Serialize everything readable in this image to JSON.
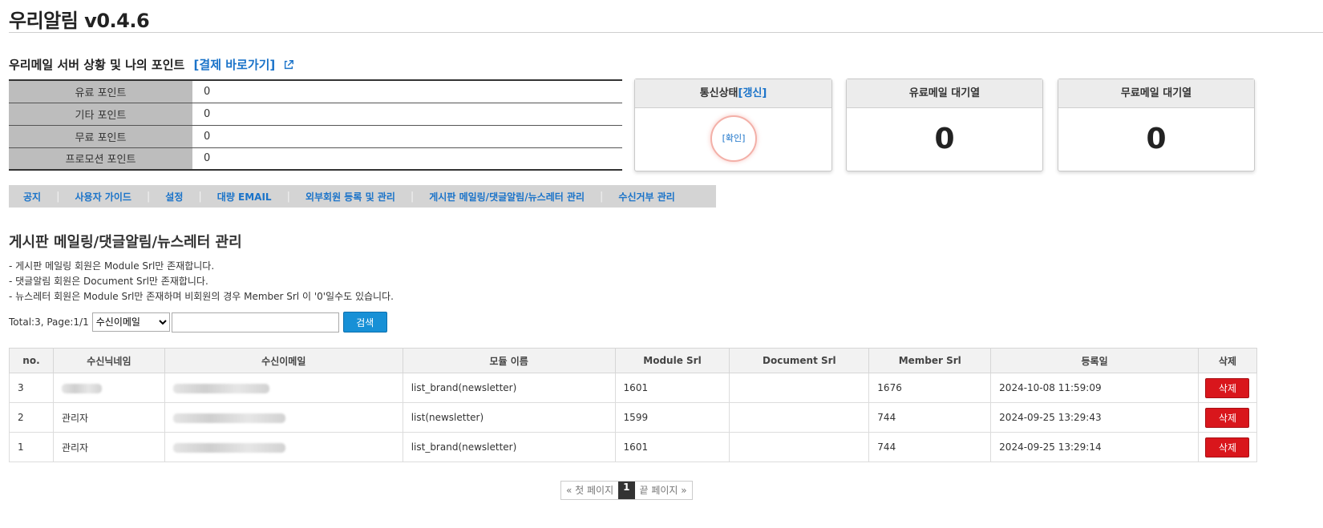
{
  "app": {
    "title": "우리알림 v0.4.6"
  },
  "points_section": {
    "heading": "우리메일 서버 상황 및 나의 포인트",
    "pay_link": "[결제 바로가기]",
    "rows": [
      {
        "label": "유료 포인트",
        "value": "0"
      },
      {
        "label": "기타 포인트",
        "value": "0"
      },
      {
        "label": "무료 포인트",
        "value": "0"
      },
      {
        "label": "프로모션 포인트",
        "value": "0"
      }
    ]
  },
  "status": {
    "comm": {
      "title": "통신상태",
      "refresh": "[갱신]",
      "confirm": "[확인]"
    },
    "paid_queue": {
      "title": "유료메일 대기열",
      "value": "0"
    },
    "free_queue": {
      "title": "무료메일 대기열",
      "value": "0"
    }
  },
  "menu": {
    "items": [
      "공지",
      "사용자 가이드",
      "설정",
      "대량 EMAIL",
      "외부회원 등록 및 관리",
      "게시판 메일링/댓글알림/뉴스레터 관리",
      "수신거부 관리"
    ]
  },
  "main": {
    "heading": "게시판 메일링/댓글알림/뉴스레터 관리",
    "notes": [
      "- 게시판 메일링 회원은 Module Srl만 존재합니다.",
      "- 댓글알림 회원은 Document Srl만 존재합니다.",
      "- 뉴스레터 회원은 Module Srl만 존재하며 비회원의 경우 Member Srl 이 '0'일수도 있습니다."
    ]
  },
  "search": {
    "total_text": "Total:3, Page:1/1",
    "selected_option": "수신이메일",
    "input_value": "",
    "button": "검색"
  },
  "table": {
    "headers": [
      "no.",
      "수신닉네임",
      "수신이메일",
      "모듈 이름",
      "Module Srl",
      "Document Srl",
      "Member Srl",
      "등록일",
      "삭제"
    ],
    "delete_label": "삭제",
    "rows": [
      {
        "no": "3",
        "nickname": "",
        "email": "",
        "module": "list_brand(newsletter)",
        "module_srl": "1601",
        "document_srl": "",
        "member_srl": "1676",
        "date": "2024-10-08 11:59:09"
      },
      {
        "no": "2",
        "nickname": "관리자",
        "email": "",
        "module": "list(newsletter)",
        "module_srl": "1599",
        "document_srl": "",
        "member_srl": "744",
        "date": "2024-09-25 13:29:43"
      },
      {
        "no": "1",
        "nickname": "관리자",
        "email": "",
        "module": "list_brand(newsletter)",
        "module_srl": "1601",
        "document_srl": "",
        "member_srl": "744",
        "date": "2024-09-25 13:29:14"
      }
    ]
  },
  "pagination": {
    "first": "« 첫 페이지",
    "current": "1",
    "last": "끝 페이지 »"
  },
  "colors": {
    "link": "#1a73c9",
    "search_button": "#1790d6",
    "delete_button": "#d9161c",
    "menu_bar": "#d4d4d4",
    "point_label_bg": "#bdbdbd"
  }
}
